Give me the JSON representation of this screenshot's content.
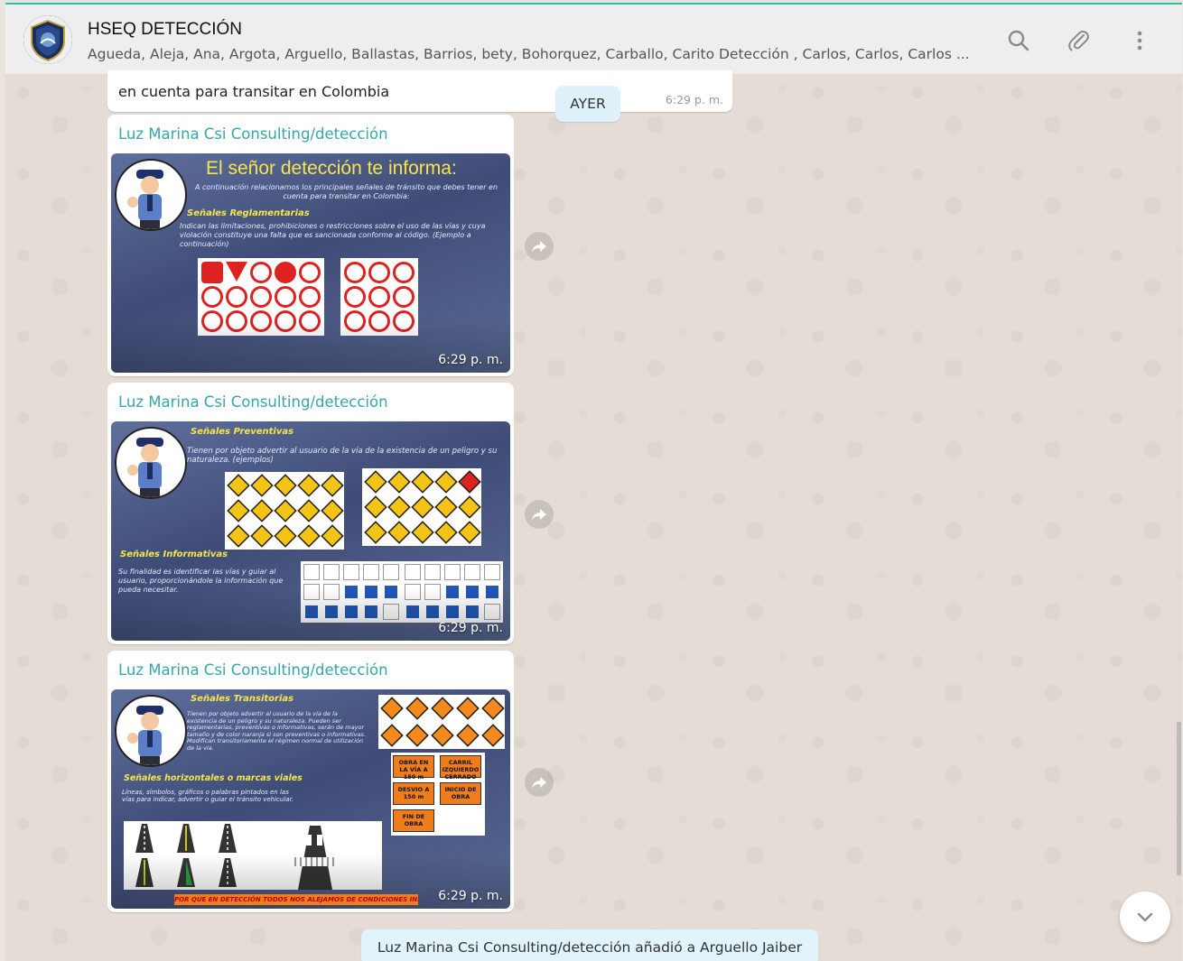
{
  "header": {
    "title": "HSEQ DETECCIÓN",
    "participants": "Agueda, Aleja, Ana, Argota, Arguello, Ballastas, Barrios, bety, Bohorquez, Carballo, Carito Detección , Carlos, Carlos, Carlos ...",
    "icons": [
      "search-icon",
      "attach-icon",
      "menu-icon"
    ]
  },
  "previous_message": {
    "text": "en cuenta para transitar en Colombia",
    "time": "6:29 p. m."
  },
  "day_label": "AYER",
  "messages": [
    {
      "sender": "Luz Marina Csi Consulting/detección",
      "time": "6:29 p. m.",
      "slide_title": "El señor detección te informa:",
      "intro": "A continuación relacionamos los principales señales de tránsito que debes tener en cuenta para transitar en Colombia:",
      "heading": "Señales Reglamentarias",
      "body": "Indican las limitaciones, prohibiciones o restricciones sobre el uso de las vías y cuya violación constituye una falta que es sancionada conforme al código. (Ejemplo a continuación)"
    },
    {
      "sender": "Luz Marina Csi Consulting/detección",
      "time": "6:29 p. m.",
      "heading": "Señales Preventivas",
      "body": "Tienen por objeto advertir al usuario de la vía de la existencia de un peligro y su naturaleza. (ejemplos)",
      "heading2": "Señales Informativas",
      "body2": "Su finalidad es identificar las vías y guiar al usuario, proporcionándole la información que pueda necesitar."
    },
    {
      "sender": "Luz Marina Csi Consulting/detección",
      "time": "6:29 p. m.",
      "heading": "Señales Transitorias",
      "body": "Tienen por objeto advertir al usuario de la vía de la existencia de un peligro y su naturaleza. Pueden ser reglamentarias, preventivas o informativas, serán de mayor tamaño y de color naranja si son preventivas o informativas. Modifican transitoriamente el régimen normal de utilización de la vía.",
      "heading2": "Señales horizontales o marcas viales",
      "body2": "Líneas, símbolos, gráficos o palabras pintados en las vías para indicar, advertir o guiar el tránsito vehicular.",
      "footer": "POR QUE EN DETECCIÓN TODOS NOS ALEJAMOS DE CONDICIONES INSEGURAS",
      "work_signs": [
        "OBRA EN LA VÍA A 150 m",
        "CARRIL IZQUIERDO CERRADO",
        "DESVIO A 150 m",
        "INICIO DE OBRA",
        "FIN DE OBRA"
      ]
    }
  ],
  "system_message": "Luz Marina Csi Consulting/detección añadió a Arguello Jaiber",
  "colors": {
    "accent": "#2cbfb0",
    "sender": "#35a7a7",
    "chat_bg": "#e5ddd5",
    "pill": "#e1f3fb"
  }
}
